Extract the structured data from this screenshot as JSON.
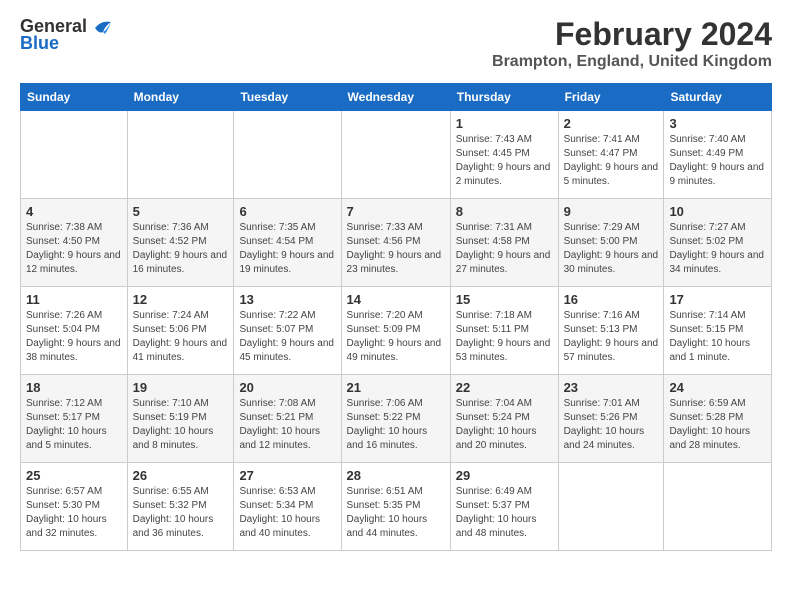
{
  "logo": {
    "general": "General",
    "blue": "Blue"
  },
  "title": {
    "month": "February 2024",
    "location": "Brampton, England, United Kingdom"
  },
  "headers": [
    "Sunday",
    "Monday",
    "Tuesday",
    "Wednesday",
    "Thursday",
    "Friday",
    "Saturday"
  ],
  "weeks": [
    [
      {
        "day": "",
        "info": ""
      },
      {
        "day": "",
        "info": ""
      },
      {
        "day": "",
        "info": ""
      },
      {
        "day": "",
        "info": ""
      },
      {
        "day": "1",
        "info": "Sunrise: 7:43 AM\nSunset: 4:45 PM\nDaylight: 9 hours and 2 minutes."
      },
      {
        "day": "2",
        "info": "Sunrise: 7:41 AM\nSunset: 4:47 PM\nDaylight: 9 hours and 5 minutes."
      },
      {
        "day": "3",
        "info": "Sunrise: 7:40 AM\nSunset: 4:49 PM\nDaylight: 9 hours and 9 minutes."
      }
    ],
    [
      {
        "day": "4",
        "info": "Sunrise: 7:38 AM\nSunset: 4:50 PM\nDaylight: 9 hours and 12 minutes."
      },
      {
        "day": "5",
        "info": "Sunrise: 7:36 AM\nSunset: 4:52 PM\nDaylight: 9 hours and 16 minutes."
      },
      {
        "day": "6",
        "info": "Sunrise: 7:35 AM\nSunset: 4:54 PM\nDaylight: 9 hours and 19 minutes."
      },
      {
        "day": "7",
        "info": "Sunrise: 7:33 AM\nSunset: 4:56 PM\nDaylight: 9 hours and 23 minutes."
      },
      {
        "day": "8",
        "info": "Sunrise: 7:31 AM\nSunset: 4:58 PM\nDaylight: 9 hours and 27 minutes."
      },
      {
        "day": "9",
        "info": "Sunrise: 7:29 AM\nSunset: 5:00 PM\nDaylight: 9 hours and 30 minutes."
      },
      {
        "day": "10",
        "info": "Sunrise: 7:27 AM\nSunset: 5:02 PM\nDaylight: 9 hours and 34 minutes."
      }
    ],
    [
      {
        "day": "11",
        "info": "Sunrise: 7:26 AM\nSunset: 5:04 PM\nDaylight: 9 hours and 38 minutes."
      },
      {
        "day": "12",
        "info": "Sunrise: 7:24 AM\nSunset: 5:06 PM\nDaylight: 9 hours and 41 minutes."
      },
      {
        "day": "13",
        "info": "Sunrise: 7:22 AM\nSunset: 5:07 PM\nDaylight: 9 hours and 45 minutes."
      },
      {
        "day": "14",
        "info": "Sunrise: 7:20 AM\nSunset: 5:09 PM\nDaylight: 9 hours and 49 minutes."
      },
      {
        "day": "15",
        "info": "Sunrise: 7:18 AM\nSunset: 5:11 PM\nDaylight: 9 hours and 53 minutes."
      },
      {
        "day": "16",
        "info": "Sunrise: 7:16 AM\nSunset: 5:13 PM\nDaylight: 9 hours and 57 minutes."
      },
      {
        "day": "17",
        "info": "Sunrise: 7:14 AM\nSunset: 5:15 PM\nDaylight: 10 hours and 1 minute."
      }
    ],
    [
      {
        "day": "18",
        "info": "Sunrise: 7:12 AM\nSunset: 5:17 PM\nDaylight: 10 hours and 5 minutes."
      },
      {
        "day": "19",
        "info": "Sunrise: 7:10 AM\nSunset: 5:19 PM\nDaylight: 10 hours and 8 minutes."
      },
      {
        "day": "20",
        "info": "Sunrise: 7:08 AM\nSunset: 5:21 PM\nDaylight: 10 hours and 12 minutes."
      },
      {
        "day": "21",
        "info": "Sunrise: 7:06 AM\nSunset: 5:22 PM\nDaylight: 10 hours and 16 minutes."
      },
      {
        "day": "22",
        "info": "Sunrise: 7:04 AM\nSunset: 5:24 PM\nDaylight: 10 hours and 20 minutes."
      },
      {
        "day": "23",
        "info": "Sunrise: 7:01 AM\nSunset: 5:26 PM\nDaylight: 10 hours and 24 minutes."
      },
      {
        "day": "24",
        "info": "Sunrise: 6:59 AM\nSunset: 5:28 PM\nDaylight: 10 hours and 28 minutes."
      }
    ],
    [
      {
        "day": "25",
        "info": "Sunrise: 6:57 AM\nSunset: 5:30 PM\nDaylight: 10 hours and 32 minutes."
      },
      {
        "day": "26",
        "info": "Sunrise: 6:55 AM\nSunset: 5:32 PM\nDaylight: 10 hours and 36 minutes."
      },
      {
        "day": "27",
        "info": "Sunrise: 6:53 AM\nSunset: 5:34 PM\nDaylight: 10 hours and 40 minutes."
      },
      {
        "day": "28",
        "info": "Sunrise: 6:51 AM\nSunset: 5:35 PM\nDaylight: 10 hours and 44 minutes."
      },
      {
        "day": "29",
        "info": "Sunrise: 6:49 AM\nSunset: 5:37 PM\nDaylight: 10 hours and 48 minutes."
      },
      {
        "day": "",
        "info": ""
      },
      {
        "day": "",
        "info": ""
      }
    ]
  ]
}
